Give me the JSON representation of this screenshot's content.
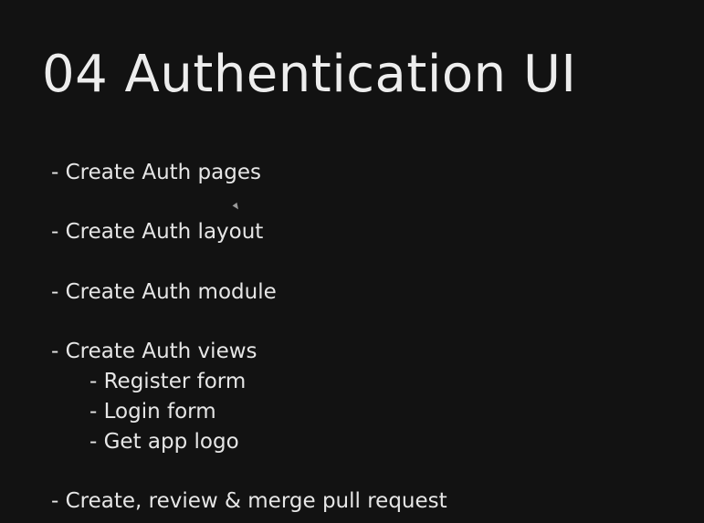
{
  "slide": {
    "title": "04 Authentication UI",
    "items": [
      "- Create Auth pages",
      "- Create Auth layout",
      "- Create Auth module",
      "- Create Auth views",
      "- Register form",
      "- Login form",
      "- Get app logo",
      "- Create, review & merge pull request"
    ]
  },
  "colors": {
    "background": "#121212",
    "text": "#e6e6e6"
  }
}
